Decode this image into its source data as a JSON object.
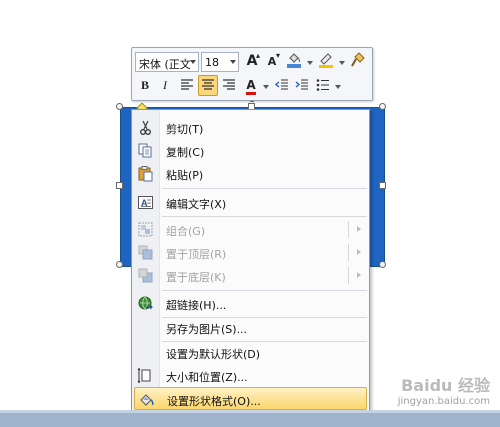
{
  "mini_toolbar": {
    "font_name": "宋体 (正文",
    "font_size": "18",
    "grow_font_glyph": "A",
    "shrink_font_glyph": "A",
    "bold": "B",
    "italic": "I",
    "font_color_glyph": "A",
    "align_center_active": true,
    "colors": {
      "fill": "#4a86d8",
      "line": "#f5c400",
      "font": "#d81010"
    }
  },
  "context_menu": {
    "items": [
      {
        "label": "剪切(T)",
        "icon": "scissors-icon",
        "disabled": false
      },
      {
        "label": "复制(C)",
        "icon": "copy-icon",
        "disabled": false
      },
      {
        "label": "粘贴(P)",
        "icon": "paste-icon",
        "disabled": false
      },
      {
        "label": "编辑文字(X)",
        "icon": "edit-text-icon",
        "disabled": false
      },
      {
        "label": "组合(G)",
        "icon": "group-icon",
        "disabled": true,
        "submenu": true
      },
      {
        "label": "置于顶层(R)",
        "icon": "bring-to-front-icon",
        "disabled": true,
        "submenu": true
      },
      {
        "label": "置于底层(K)",
        "icon": "send-to-back-icon",
        "disabled": true,
        "submenu": true
      },
      {
        "label": "超链接(H)...",
        "icon": "hyperlink-icon",
        "disabled": false
      },
      {
        "label": "另存为图片(S)...",
        "icon": "",
        "disabled": false
      },
      {
        "label": "设置为默认形状(D)",
        "icon": "",
        "disabled": false
      },
      {
        "label": "大小和位置(Z)...",
        "icon": "size-position-icon",
        "disabled": false
      },
      {
        "label": "设置形状格式(O)...",
        "icon": "format-shape-icon",
        "disabled": false,
        "highlighted": true
      }
    ]
  },
  "shape": {
    "fill": "#1e64c0"
  },
  "watermark": {
    "brand": "Baidu 经验",
    "url": "jingyan.baidu.com"
  }
}
